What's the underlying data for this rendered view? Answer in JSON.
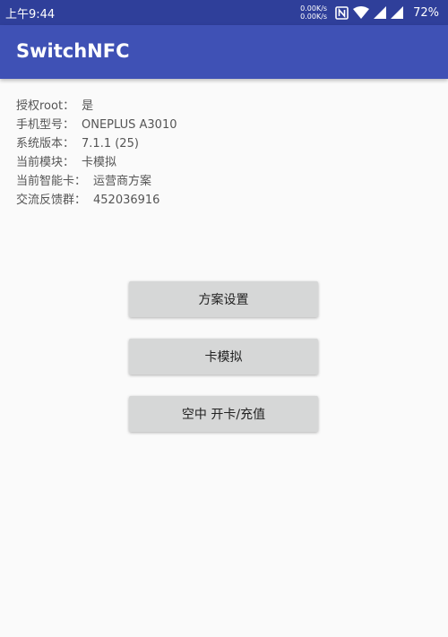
{
  "status_bar": {
    "time": "上午9:44",
    "net_speed_up": "0.00K/s",
    "net_speed_down": "0.00K/s",
    "battery": "72%",
    "icons": [
      "nfc-icon",
      "wifi-icon",
      "signal-icon",
      "signal-icon",
      "battery-icon"
    ]
  },
  "app_bar": {
    "title": "SwitchNFC"
  },
  "info": {
    "rows": [
      {
        "label": "授权root：",
        "value": "是"
      },
      {
        "label": "手机型号：",
        "value": "ONEPLUS A3010"
      },
      {
        "label": "系统版本：",
        "value": "7.1.1 (25)"
      },
      {
        "label": "当前模块：",
        "value": "卡模拟"
      },
      {
        "label": "当前智能卡：",
        "value": "运营商方案"
      },
      {
        "label": "交流反馈群：",
        "value": "452036916"
      }
    ]
  },
  "buttons": {
    "scheme_settings": "方案设置",
    "card_emulation": "卡模拟",
    "ota_topup": "空中 开卡/充值"
  },
  "colors": {
    "status_bar": "#2f3f9a",
    "app_bar": "#3f51b5",
    "button": "#d6d7d7",
    "background": "#fafafa"
  }
}
